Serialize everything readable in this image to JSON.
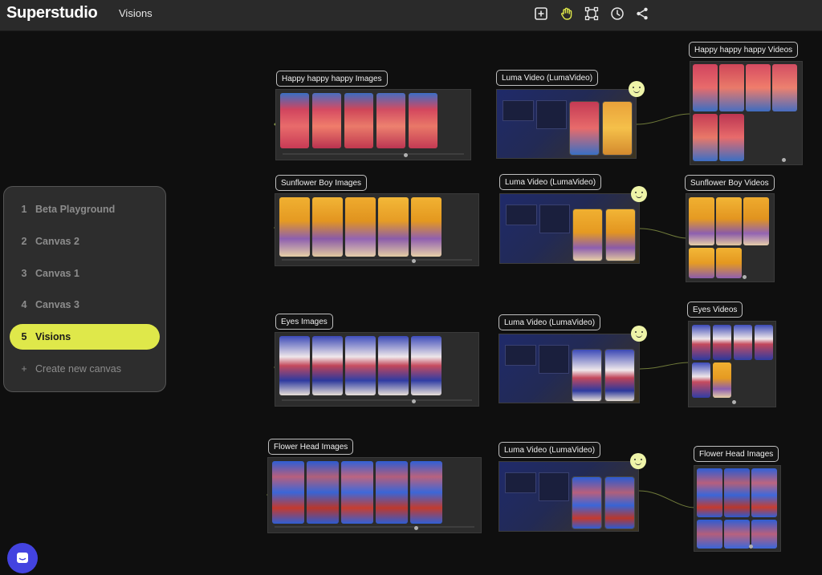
{
  "app": {
    "brand": "Superstudio",
    "project": "Visions"
  },
  "toolbar": [
    {
      "name": "add-frame-icon"
    },
    {
      "name": "hand-tool-icon"
    },
    {
      "name": "frame-select-icon"
    },
    {
      "name": "history-icon"
    },
    {
      "name": "share-icon"
    }
  ],
  "colors": {
    "accent": "#dfe84a",
    "canvas_bg": "#0f0f0f",
    "topbar_bg": "#2a2a2a",
    "chat_button": "#4343e0"
  },
  "canvas_menu": {
    "items": [
      {
        "num": "1",
        "label": "Beta Playground",
        "active": false
      },
      {
        "num": "2",
        "label": "Canvas 2",
        "active": false
      },
      {
        "num": "3",
        "label": "Canvas 1",
        "active": false
      },
      {
        "num": "4",
        "label": "Canvas 3",
        "active": false
      },
      {
        "num": "5",
        "label": "Visions",
        "active": true
      },
      {
        "num": "+",
        "label": "Create new canvas",
        "active": false
      }
    ]
  },
  "rows": [
    {
      "images_label": "Happy happy happy Images",
      "video_label": "Luma Video (LumaVideo)",
      "videos_label": "Happy happy happy Videos",
      "theme": "happy"
    },
    {
      "images_label": "Sunflower Boy Images",
      "video_label": "Luma Video (LumaVideo)",
      "videos_label": "Sunflower Boy Videos",
      "theme": "sunflower"
    },
    {
      "images_label": "Eyes Images",
      "video_label": "Luma Video (LumaVideo)",
      "videos_label": "Eyes Videos",
      "theme": "eyes"
    },
    {
      "images_label": "Flower Head Images",
      "video_label": "Luma Video (LumaVideo)",
      "videos_label": "Flower Head Images",
      "theme": "flower"
    }
  ]
}
